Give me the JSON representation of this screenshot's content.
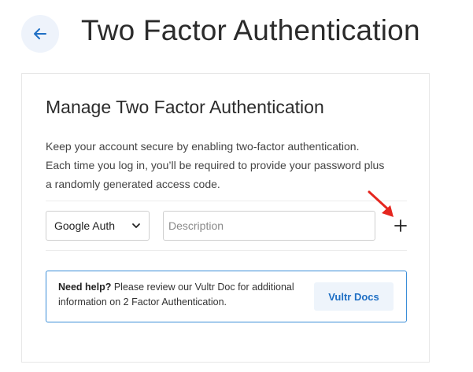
{
  "header": {
    "title": "Two Factor Authentication",
    "back_icon": "arrow-left-icon"
  },
  "card": {
    "title": "Manage Two Factor Authentication",
    "description_lines": [
      "Keep your account secure by enabling two-factor authentication.",
      "Each time you log in, you’ll be required to provide your password plus",
      "a randomly generated access code."
    ],
    "form": {
      "method_select": {
        "selected": "Google Auth"
      },
      "description_input": {
        "value": "",
        "placeholder": "Description"
      },
      "add_icon": "plus-icon"
    },
    "help": {
      "lead": "Need help?",
      "line1_rest": " Please review our Vultr Doc for additional",
      "line2": "information on 2 Factor Authentication.",
      "button_label": "Vultr Docs"
    }
  },
  "colors": {
    "accent": "#1f6fc4",
    "help_border": "#3b8ed8",
    "annotation_arrow": "#e5261f"
  }
}
